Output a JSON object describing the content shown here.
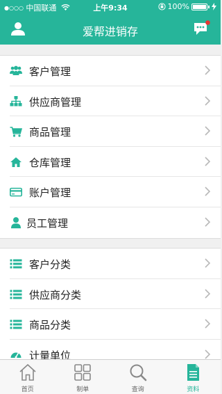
{
  "status_bar": {
    "signal_dots": "●○○○",
    "carrier": "中国联通",
    "time": "上午9:34",
    "battery": "100%"
  },
  "header": {
    "title": "爱帮进销存"
  },
  "colors": {
    "accent": "#26b59a",
    "badge": "#e53935"
  },
  "menu_group_1": [
    {
      "label": "客户管理",
      "icon": "people-icon"
    },
    {
      "label": "供应商管理",
      "icon": "org-chart-icon"
    },
    {
      "label": "商品管理",
      "icon": "cart-icon"
    },
    {
      "label": "仓库管理",
      "icon": "home-icon"
    },
    {
      "label": "账户管理",
      "icon": "card-icon"
    },
    {
      "label": "员工管理",
      "icon": "person-icon"
    }
  ],
  "menu_group_2": [
    {
      "label": "客户分类",
      "icon": "list-icon"
    },
    {
      "label": "供应商分类",
      "icon": "list-icon"
    },
    {
      "label": "商品分类",
      "icon": "list-icon"
    },
    {
      "label": "计量单位",
      "icon": "gauge-icon"
    }
  ],
  "tabs": [
    {
      "label": "首页",
      "icon": "home-outline-icon"
    },
    {
      "label": "制单",
      "icon": "grid-icon"
    },
    {
      "label": "查询",
      "icon": "search-icon"
    },
    {
      "label": "资料",
      "icon": "document-icon",
      "active": true
    }
  ]
}
